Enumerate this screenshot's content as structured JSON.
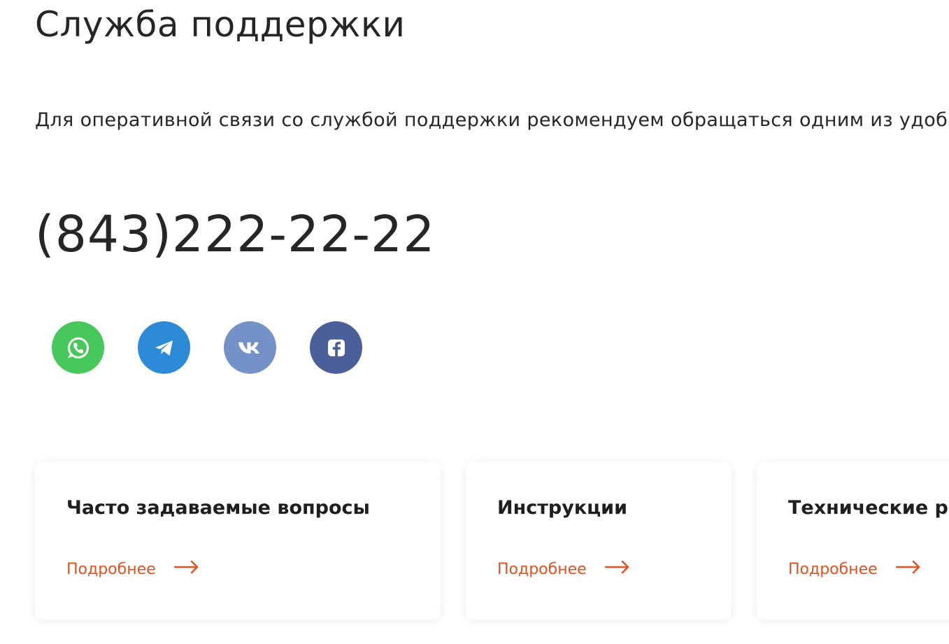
{
  "page": {
    "title": "Служба поддержки",
    "intro": "Для оперативной связи со службой поддержки рекомендуем обращаться одним из удоб",
    "phone": "(843)222-22-22"
  },
  "socials": [
    {
      "name": "WhatsApp",
      "icon": "whatsapp-icon",
      "color": "#46c95a"
    },
    {
      "name": "Telegram",
      "icon": "telegram-icon",
      "color": "#2d8ad6"
    },
    {
      "name": "VK",
      "icon": "vk-icon",
      "color": "#7592c8"
    },
    {
      "name": "Facebook",
      "icon": "facebook-icon",
      "color": "#4b5f98"
    }
  ],
  "cards": [
    {
      "title": "Часто задаваемые вопросы",
      "link": "Подробнее"
    },
    {
      "title": "Инструкции",
      "link": "Подробнее"
    },
    {
      "title": "Технические ра",
      "link": "Подробнее"
    }
  ],
  "colors": {
    "accent": "#e8501e",
    "text": "#262626"
  }
}
